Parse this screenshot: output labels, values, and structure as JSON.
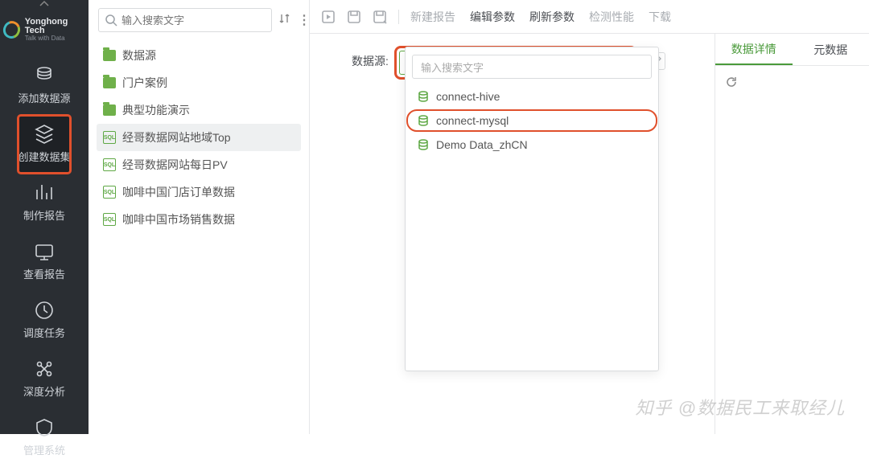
{
  "brand": {
    "name": "Yonghong Tech",
    "tag": "Talk with Data"
  },
  "nav": {
    "items": [
      {
        "label": "添加数据源"
      },
      {
        "label": "创建数据集"
      },
      {
        "label": "制作报告"
      },
      {
        "label": "查看报告"
      },
      {
        "label": "调度任务"
      },
      {
        "label": "深度分析"
      },
      {
        "label": "管理系统"
      }
    ],
    "active": 1
  },
  "tree": {
    "search_placeholder": "输入搜索文字",
    "items": [
      {
        "type": "folder",
        "label": "数据源"
      },
      {
        "type": "folder",
        "label": "门户案例"
      },
      {
        "type": "folder",
        "label": "典型功能演示"
      },
      {
        "type": "sql",
        "label": "经哥数据网站地域Top",
        "sel": true
      },
      {
        "type": "sql",
        "label": "经哥数据网站每日PV"
      },
      {
        "type": "sql",
        "label": "咖啡中国门店订单数据"
      },
      {
        "type": "sql",
        "label": "咖啡中国市场销售数据"
      }
    ]
  },
  "toolbar": {
    "links": [
      {
        "label": "新建报告"
      },
      {
        "label": "编辑参数",
        "dk": true
      },
      {
        "label": "刷新参数",
        "dk": true
      },
      {
        "label": "检测性能"
      },
      {
        "label": "下载"
      }
    ]
  },
  "ds": {
    "label": "数据源:",
    "value": "",
    "search_placeholder": "输入搜索文字",
    "options": [
      {
        "label": "connect-hive"
      },
      {
        "label": "connect-mysql",
        "hl": true
      },
      {
        "label": "Demo Data_zhCN"
      }
    ]
  },
  "rtabs": {
    "a": "数据详情",
    "b": "元数据"
  },
  "watermark": "知乎 @数据民工来取经儿"
}
